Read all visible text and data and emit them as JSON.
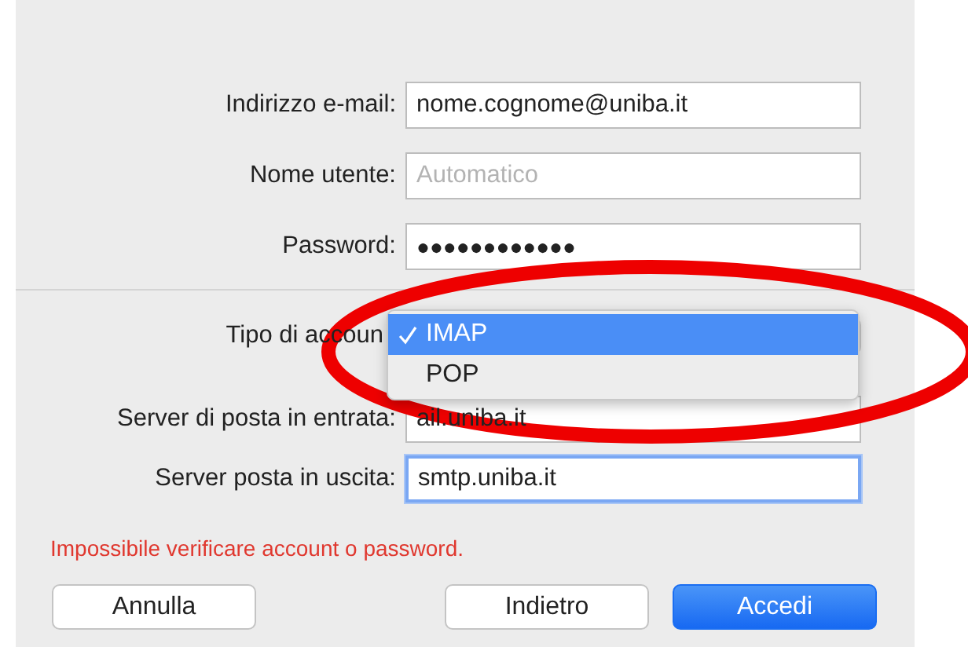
{
  "fields": [
    {
      "label": "Indirizzo e-mail:",
      "value": "nome.cognome@uniba.it",
      "kind": "text"
    },
    {
      "label": "Nome utente:",
      "placeholder": "Automatico",
      "kind": "text"
    },
    {
      "label": "Password:",
      "value": "●●●●●●●●●●●●",
      "kind": "password"
    }
  ],
  "account_type": {
    "label": "Tipo di accoun",
    "options": [
      {
        "label": "IMAP",
        "selected": true
      },
      {
        "label": "POP",
        "selected": false
      }
    ]
  },
  "servers": [
    {
      "label": "Server di posta in entrata:",
      "value": "ail.uniba.it",
      "focused": false
    },
    {
      "label": "Server posta in uscita:",
      "value": "smtp.uniba.it",
      "focused": true
    }
  ],
  "error": "Impossibile verificare account o password.",
  "buttons": [
    {
      "label": "Annulla",
      "kind": "secondary"
    },
    {
      "label": "Indietro",
      "kind": "secondary"
    },
    {
      "label": "Accedi",
      "kind": "primary"
    }
  ]
}
